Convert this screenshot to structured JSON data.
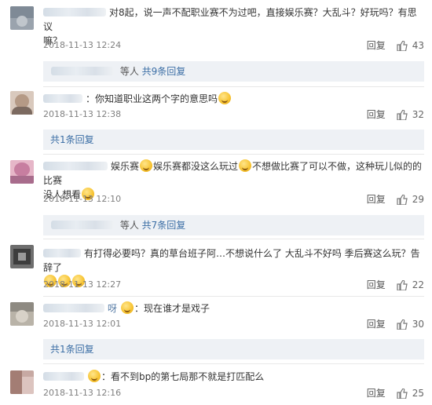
{
  "reply_label": "回复",
  "comments": [
    {
      "text": "对8起，说一声不配职业赛不为过吧，直接娱乐赛？大乱斗？好玩吗？有思议",
      "text2": "嘛？",
      "time": "2018-11-13 12:24",
      "likes": "43",
      "sub": {
        "prefix": "等人",
        "link": "共9条回复"
      }
    },
    {
      "name_tail": "",
      "text": "：你知道职业这两个字的意思吗",
      "time": "2018-11-13 12:38",
      "likes": "32",
      "sub": {
        "link": "共1条回复"
      }
    },
    {
      "text_a": "娱乐赛",
      "text_b": "娱乐赛都没这么玩过",
      "text_c": "不想做比赛了可以不做，这种玩儿似的的比赛",
      "text2": "没人想看",
      "time": "2018-11-13 12:10",
      "likes": "29",
      "sub": {
        "prefix": "等人",
        "link": "共7条回复"
      }
    },
    {
      "text": "有打得必要吗？真的草台班子阿…不想说什么了 大乱斗不好吗 季后赛这么玩？告辞了",
      "time": "2018-11-13 12:27",
      "likes": "22"
    },
    {
      "name_tail": "呀",
      "text": "：现在谁才是戏子",
      "time": "2018-11-13 12:01",
      "likes": "30",
      "sub": {
        "link": "共1条回复"
      }
    },
    {
      "text": "：看不到bp的第七局那不就是打匹配么",
      "time": "2018-11-13 12:16",
      "likes": "25"
    }
  ]
}
